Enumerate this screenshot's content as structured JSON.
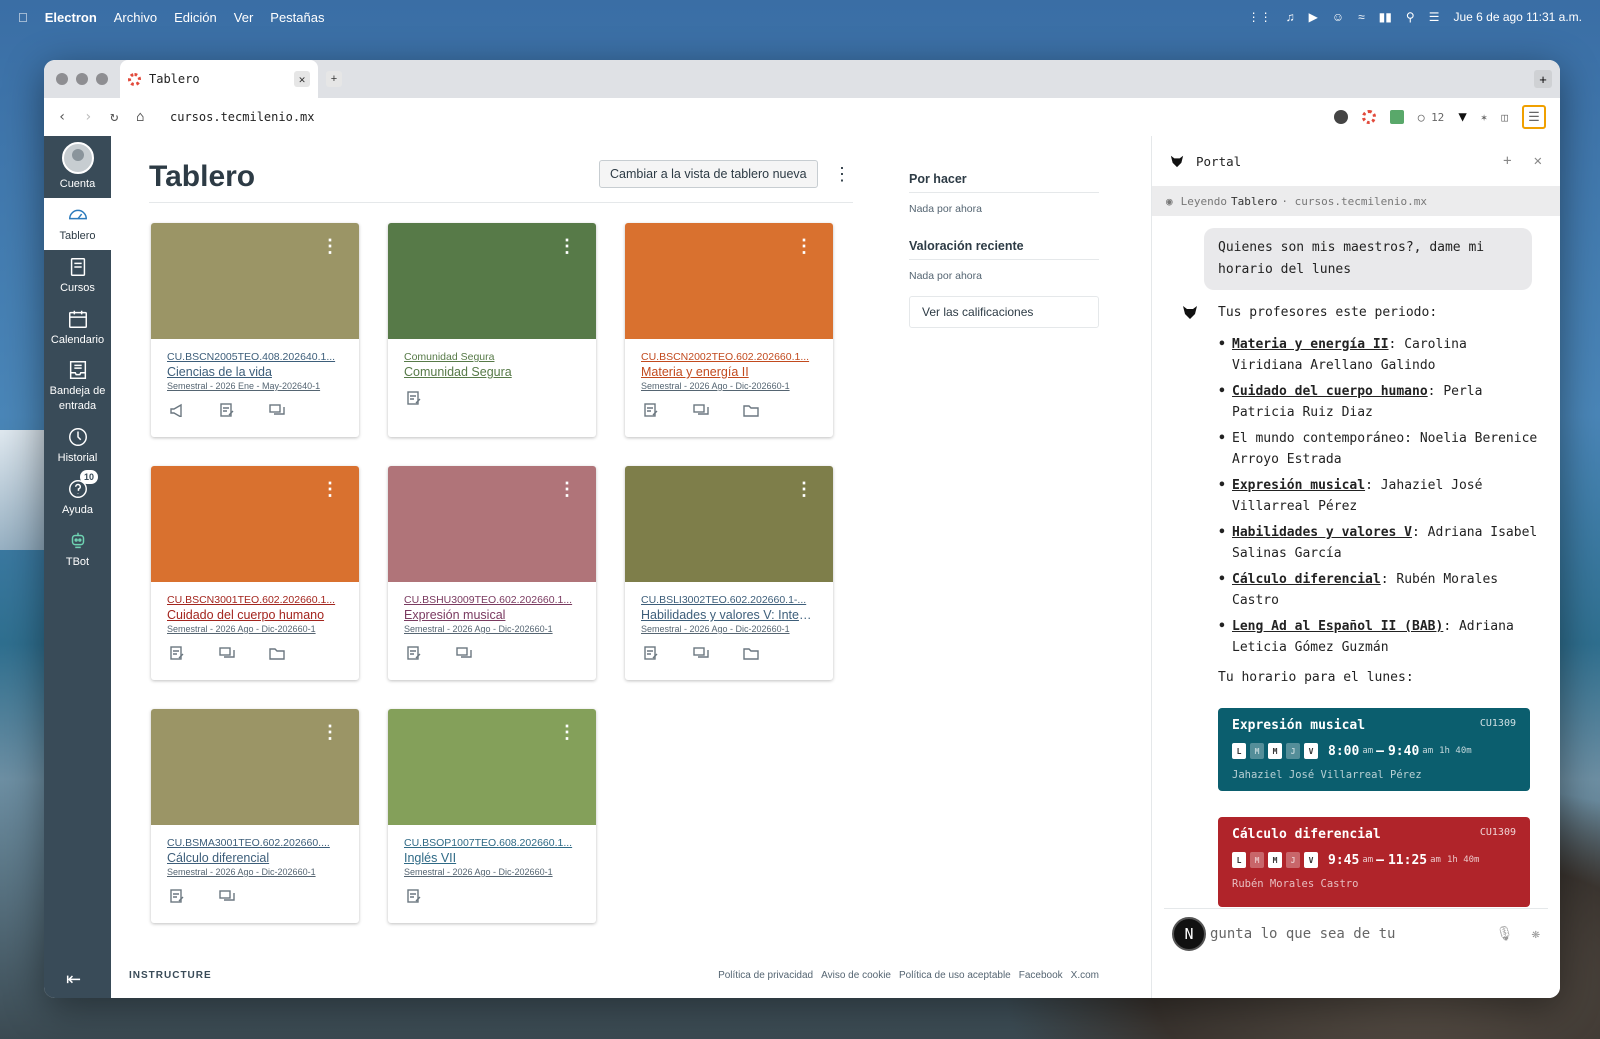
{
  "menubar": {
    "app": "Electron",
    "items": [
      "Archivo",
      "Edición",
      "Ver",
      "Pestañas"
    ],
    "datetime": "Jue 6 de ago  11:31 a.m."
  },
  "browser": {
    "tab_title": "Tablero",
    "url": "cursos.tecmilenio.mx",
    "shield_count": "12"
  },
  "global_nav": {
    "account": "Cuenta",
    "dashboard": "Tablero",
    "courses": "Cursos",
    "calendar": "Calendario",
    "inbox": "Bandeja de entrada",
    "history": "Historial",
    "help": "Ayuda",
    "help_badge": "10",
    "tbot": "TBot"
  },
  "dashboard": {
    "title": "Tablero",
    "switch_view": "Cambiar a la vista de tablero nueva",
    "cards": [
      {
        "code": "CU.BSCN2005TEO.408.202640.1...",
        "name": "Ciencias de la vida",
        "term": "Semestral - 2026 Ene - May-202640-1",
        "color": "#9b9566",
        "code_color": "#3d5e7a"
      },
      {
        "code": "Comunidad Segura",
        "name": "Comunidad Segura",
        "term": "",
        "color": "#577a48",
        "code_color": "#577a48"
      },
      {
        "code": "CU.BSCN2002TEO.602.202660.1...",
        "name": "Materia y energía II",
        "term": "Semestral - 2026 Ago - Dic-202660-1",
        "color": "#d9712f",
        "code_color": "#c24a1e"
      },
      {
        "code": "CU.BSCN3001TEO.602.202660.1...",
        "name": "Cuidado del cuerpo humano",
        "term": "Semestral - 2026 Ago - Dic-202660-1",
        "color": "#d9712f",
        "code_color": "#a3251e"
      },
      {
        "code": "CU.BSHU3009TEO.602.202660.1...",
        "name": "Expresión musical",
        "term": "Semestral - 2026 Ago - Dic-202660-1",
        "color": "#b07479",
        "code_color": "#7a3a60"
      },
      {
        "code": "CU.BSLI3002TEO.602.202660.1-...",
        "name": "Habilidades y valores V: Integr...",
        "term": "Semestral - 2026 Ago - Dic-202660-1",
        "color": "#7e7e4a",
        "code_color": "#3d5e7a"
      },
      {
        "code": "CU.BSMA3001TEO.602.202660....",
        "name": "Cálculo diferencial",
        "term": "Semestral - 2026 Ago - Dic-202660-1",
        "color": "#9b9566",
        "code_color": "#3d5e7a"
      },
      {
        "code": "CU.BSOP1007TEO.608.202660.1...",
        "name": "Inglés VII",
        "term": "Semestral - 2026 Ago - Dic-202660-1",
        "color": "#84a05a",
        "code_color": "#2f6a86"
      }
    ]
  },
  "todo": {
    "title": "Por hacer",
    "todo_empty": "Nada por ahora",
    "recent_title": "Valoración reciente",
    "recent_empty": "Nada por ahora",
    "grades_button": "Ver las calificaciones"
  },
  "footer": {
    "brand": "INSTRUCTURE",
    "links": [
      "Política de privacidad",
      "Aviso de cookie",
      "Política de uso aceptable",
      "Facebook",
      "X.com"
    ]
  },
  "portal": {
    "title": "Portal",
    "reading_label": "Leyendo",
    "reading_page": "Tablero",
    "reading_site": "· cursos.tecmilenio.mx",
    "user_message": "Quienes son mis maestros?, dame mi horario del lunes",
    "intro": "Tus profesores este periodo:",
    "teachers": [
      {
        "course": "Materia y energía II",
        "teacher": ": Carolina Viridiana Arellano Galindo",
        "underline": true
      },
      {
        "course": "Cuidado del cuerpo humano",
        "teacher": ": Perla Patricia Ruiz Diaz",
        "underline": true
      },
      {
        "course": "El mundo contemporáneo: Noelia Berenice Arroyo Estrada",
        "teacher": "",
        "underline": false
      },
      {
        "course": "Expresión musical",
        "teacher": ": Jahaziel José Villarreal Pérez",
        "underline": true
      },
      {
        "course": "Habilidades y valores V",
        "teacher": ": Adriana Isabel Salinas García",
        "underline": true
      },
      {
        "course": "Cálculo diferencial",
        "teacher": ": Rubén Morales Castro",
        "underline": true
      },
      {
        "course": "Leng Ad al Español II (BAB)",
        "teacher": ": Adriana Leticia Gómez Guzmán",
        "underline": true
      }
    ],
    "schedule_label": "Tu horario para el lunes:",
    "schedule": [
      {
        "course": "Expresión musical",
        "room": "CU1309",
        "start": "8:00",
        "end": "9:40",
        "ampm1": "am",
        "ampm2": "am",
        "duration": "1h 40m",
        "teacher": "Jahaziel José Villarreal Pérez",
        "days_on": [
          true,
          false,
          true,
          false,
          true
        ]
      },
      {
        "course": "Cálculo diferencial",
        "room": "CU1309",
        "start": "9:45",
        "end": "11:25",
        "ampm1": "am",
        "ampm2": "am",
        "duration": "1h 40m",
        "teacher": "Rubén Morales Castro",
        "days_on": [
          true,
          false,
          true,
          false,
          true
        ]
      }
    ],
    "days": [
      "L",
      "M",
      "M",
      "J",
      "V"
    ],
    "input_placeholder": "gunta lo que sea de tu",
    "avatar_letter": "N"
  }
}
